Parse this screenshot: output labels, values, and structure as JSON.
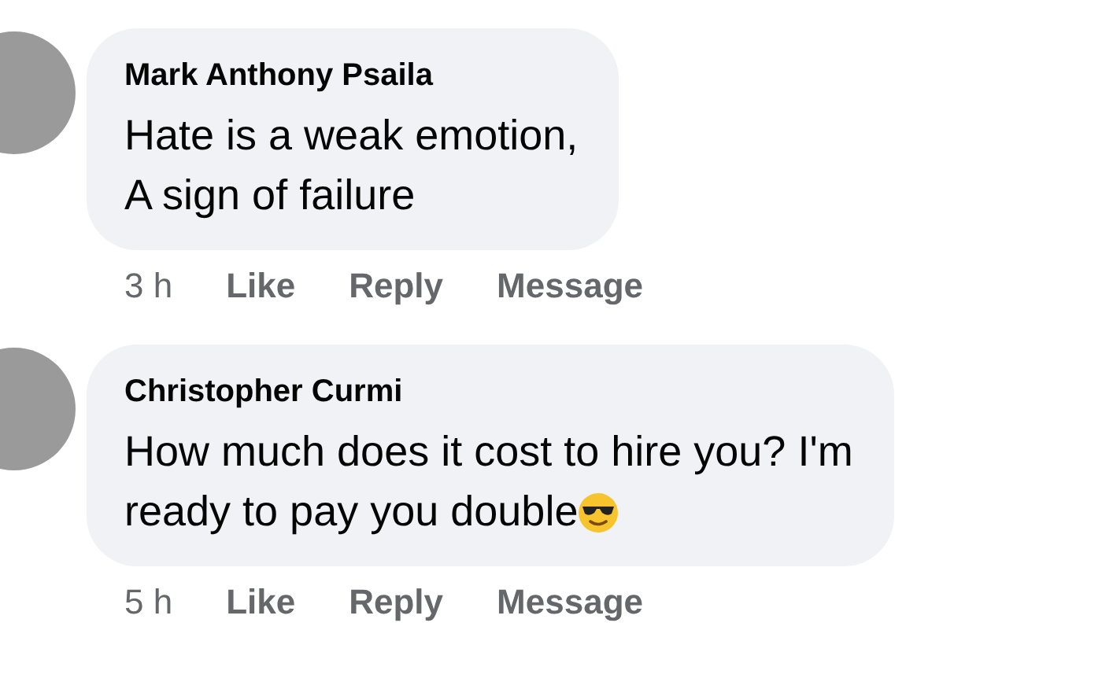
{
  "comments": [
    {
      "author": "Mark Anthony Psaila",
      "lines": [
        "Hate is a weak emotion,",
        "A sign of failure"
      ],
      "sunglasses_emoji": false,
      "time": "3 h",
      "actions": [
        "Like",
        "Reply",
        "Message"
      ]
    },
    {
      "author": "Christopher Curmi",
      "lines": [
        "How much does it cost to hire you? I'm",
        "ready to pay you double"
      ],
      "sunglasses_emoji": true,
      "time": "5 h",
      "actions": [
        "Like",
        "Reply",
        "Message"
      ]
    }
  ]
}
